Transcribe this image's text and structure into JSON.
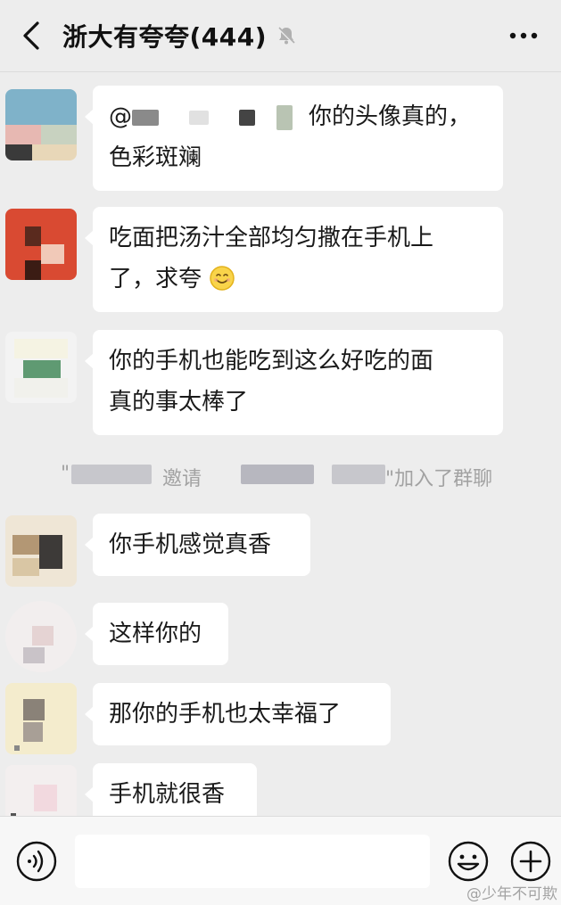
{
  "header": {
    "title": "浙大有夸夸(444)",
    "back_icon": "chevron-left-icon",
    "mute_icon": "bell-off-icon",
    "more_icon": "more-dots-icon"
  },
  "messages": [
    {
      "mention": "@",
      "text_line1": "你的头像真的，",
      "text_line2": "色彩斑斓"
    },
    {
      "text_line1": "吃面把汤汁全部均匀撒在手机上",
      "text_line2": "了，求夸",
      "emoji": "smile-emoji"
    },
    {
      "text_line1": "你的手机也能吃到这么好吃的面",
      "text_line2": "真的事太棒了"
    },
    {
      "text": "你手机感觉真香"
    },
    {
      "text": "这样你的"
    },
    {
      "text": "那你的手机也太幸福了"
    },
    {
      "text": "手机就很香"
    }
  ],
  "system_notice": {
    "open_quote": "\"",
    "invite": "邀请",
    "suffix": "\"加入了群聊"
  },
  "input": {
    "voice_icon": "voice-icon",
    "emoji_icon": "emoji-icon",
    "plus_icon": "plus-circle-icon"
  },
  "watermark": "@少年不可欺",
  "colors": {
    "background": "#ededed",
    "bubble": "#ffffff",
    "system_text": "#a2a2a2"
  }
}
